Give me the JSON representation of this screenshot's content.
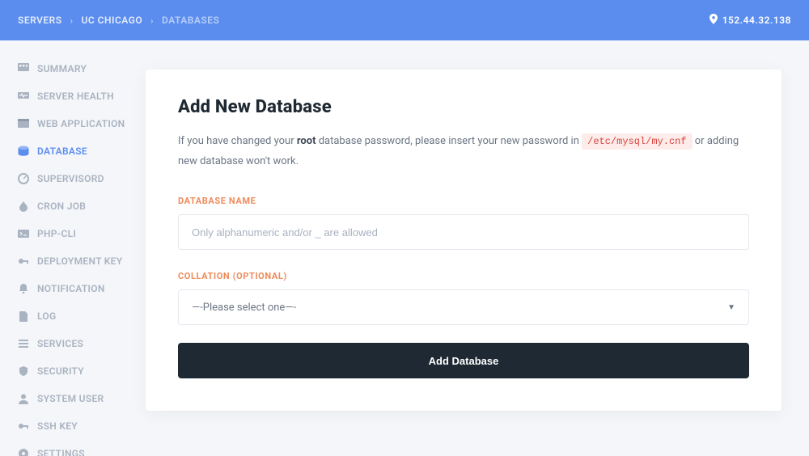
{
  "breadcrumb": {
    "c1": "SERVERS",
    "c2": "UC CHICAGO",
    "c3": "DATABASES"
  },
  "ip": "152.44.32.138",
  "sidebar": {
    "items": [
      {
        "label": "SUMMARY"
      },
      {
        "label": "SERVER HEALTH"
      },
      {
        "label": "WEB APPLICATION"
      },
      {
        "label": "DATABASE"
      },
      {
        "label": "SUPERVISORD"
      },
      {
        "label": "CRON JOB"
      },
      {
        "label": "PHP-CLI"
      },
      {
        "label": "DEPLOYMENT KEY"
      },
      {
        "label": "NOTIFICATION"
      },
      {
        "label": "LOG"
      },
      {
        "label": "SERVICES"
      },
      {
        "label": "SECURITY"
      },
      {
        "label": "SYSTEM USER"
      },
      {
        "label": "SSH KEY"
      },
      {
        "label": "SETTINGS"
      }
    ]
  },
  "page": {
    "title": "Add New Database",
    "desc1": "If you have changed your ",
    "descBold": "root",
    "desc2": " database password, please insert your new password in ",
    "descCode": "/etc/mysql/my.cnf",
    "desc3": " or adding new database won't work.",
    "field1Label": "DATABASE NAME",
    "field1Placeholder": "Only alphanumeric and/or _ are allowed",
    "field2Label": "COLLATION (OPTIONAL)",
    "field2Selected": "—-Please select one—-",
    "submit": "Add Database"
  }
}
